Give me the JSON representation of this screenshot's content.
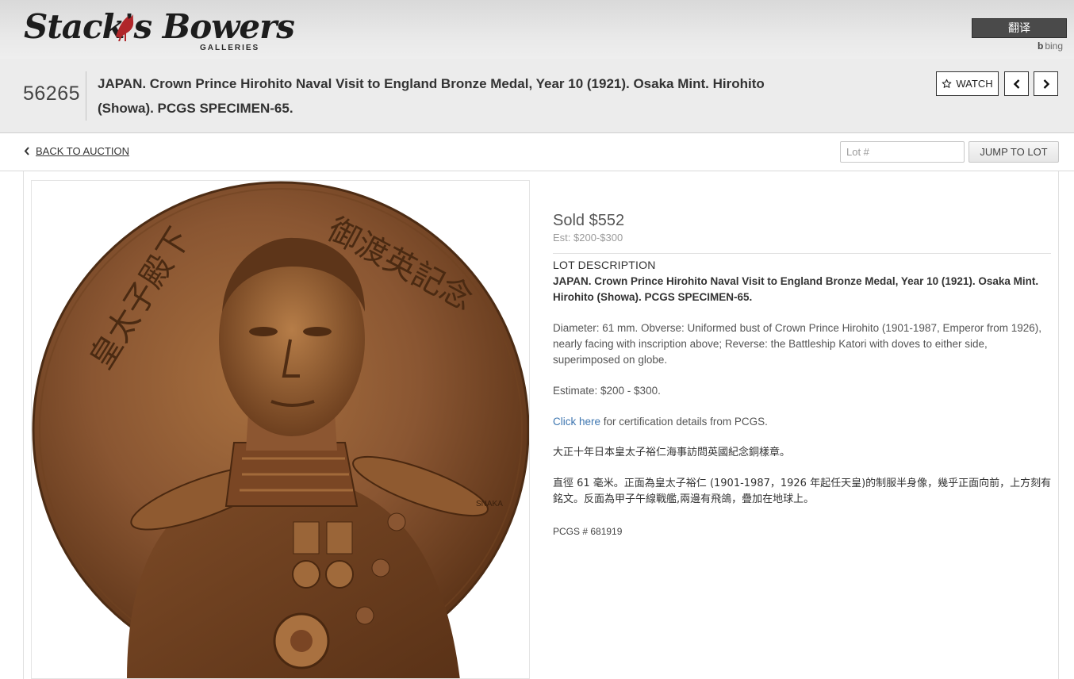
{
  "brand": {
    "name": "Stack's Bowers",
    "sub": "GALLERIES"
  },
  "translate": {
    "button_label": "翻译",
    "provider": "bing"
  },
  "lot": {
    "number": "56265",
    "title": "JAPAN. Crown Prince Hirohito Naval Visit to England Bronze Medal, Year 10 (1921). Osaka Mint. Hirohito (Showa). PCGS SPECIMEN-65.",
    "watch_label": "WATCH",
    "prev_icon": "chevron-left-icon",
    "next_icon": "chevron-right-icon"
  },
  "navbar": {
    "back_label": "BACK TO AUCTION",
    "lot_input_placeholder": "Lot #",
    "jump_label": "JUMP TO LOT"
  },
  "medal": {
    "inscription_left": "皇太子殿下",
    "inscription_right": "御渡英記念",
    "signature": "SNAKA"
  },
  "details": {
    "sold": "Sold $552",
    "estimate_short": "Est: $200-$300",
    "description_heading": "LOT DESCRIPTION",
    "description_title": "JAPAN. Crown Prince Hirohito Naval Visit to England Bronze Medal, Year 10 (1921). Osaka Mint. Hirohito (Showa). PCGS SPECIMEN-65.",
    "description_body": "Diameter: 61 mm. Obverse: Uniformed bust of Crown Prince Hirohito (1901-1987, Emperor from 1926), nearly facing with inscription above; Reverse: the Battleship Katori with doves to either side, superimposed on globe.",
    "estimate_full": "Estimate: $200 - $300.",
    "cert_link": "Click here",
    "cert_text": " for certification details from PCGS.",
    "title_cn": "大正十年日本皇太子裕仁海事訪問英國紀念銅樣章。",
    "body_cn": "直徑 61 毫米。正面為皇太子裕仁 (1901-1987，1926 年起任天皇)的制服半身像，幾乎正面向前，上方刻有銘文。反面為甲子午線戰艦,兩邊有飛鴿，疊加在地球上。",
    "pcgs_number": "PCGS # 681919"
  },
  "colors": {
    "bronze": "#8a5632",
    "link": "#3e76b0",
    "header_band": "#ececec"
  }
}
